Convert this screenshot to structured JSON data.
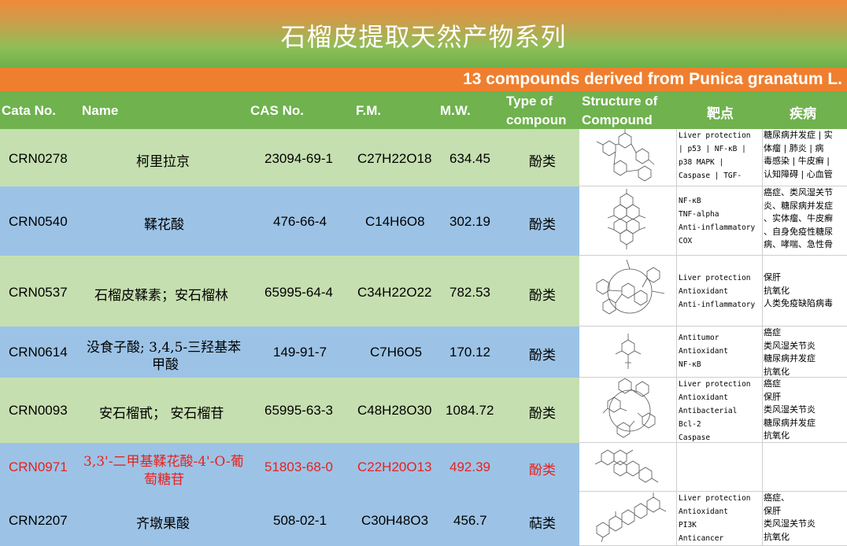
{
  "title": "石榴皮提取天然产物系列",
  "subtitle": "13 compounds derived from Punica granatum L.",
  "headers": {
    "cata": "Cata No.",
    "name": "Name",
    "cas": "CAS No.",
    "fm": "F.M.",
    "mw": "M.W.",
    "type_1": "Type of",
    "type_2": "compoun",
    "structure_1": "Structure of",
    "structure_2": "Compound",
    "target": "靶点",
    "disease": "疾病"
  },
  "colors": {
    "green_row": "#c6dfb0",
    "blue_row": "#9cc3e6",
    "header_green": "#6fb24e",
    "orange_band": "#ef7f2e",
    "highlight_red": "#e8211d"
  },
  "rows": [
    {
      "cata": "CRN0278",
      "name_1": "柯里拉京",
      "name_2": "",
      "cas": "23094-69-1",
      "fm": "C27H22O18",
      "mw": "634.45",
      "type": "酚类",
      "targets": [
        "Liver protection",
        "| p53 | NF-κB |",
        "p38 MAPK |",
        "Caspase | TGF-"
      ],
      "diseases": [
        "糖尿病并发症 | 实",
        "体瘤 | 肺炎 | 病",
        "毒感染 | 牛皮癣 |",
        "认知障碍 | 心血管"
      ]
    },
    {
      "cata": "CRN0540",
      "name_1": "鞣花酸",
      "name_2": "",
      "cas": "476-66-4",
      "fm": "C14H6O8",
      "mw": "302.19",
      "type": "酚类",
      "targets": [
        "NF-κB",
        "TNF-alpha",
        "Anti-inflammatory",
        "COX"
      ],
      "diseases": [
        "癌症、类风湿关节",
        "炎、糖尿病并发症",
        "、实体瘤、牛皮癣",
        "、自身免疫性糖尿",
        "病、哮喘、急性骨"
      ]
    },
    {
      "cata": "CRN0537",
      "name_1": "石榴皮鞣素；安石榴林",
      "name_2": "",
      "cas": "65995-64-4",
      "fm": "C34H22O22",
      "mw": "782.53",
      "type": "酚类",
      "targets": [
        "Liver protection",
        "Antioxidant",
        "Anti-inflammatory"
      ],
      "diseases": [
        "保肝",
        "抗氧化",
        "人类免疫缺陷病毒"
      ]
    },
    {
      "cata": "CRN0614",
      "name_1": "没食子酸; 3,4,5-三羟基苯",
      "name_2": "甲酸",
      "cas": "149-91-7",
      "fm": "C7H6O5",
      "mw": "170.12",
      "type": "酚类",
      "targets": [
        "Antitumor",
        "Antioxidant",
        "NF-κB"
      ],
      "diseases": [
        "癌症",
        "类风湿关节炎",
        "糖尿病并发症",
        "抗氧化"
      ]
    },
    {
      "cata": "CRN0093",
      "name_1": "安石榴甙； 安石榴苷",
      "name_2": "",
      "cas": "65995-63-3",
      "fm": "C48H28O30",
      "mw": "1084.72",
      "type": "酚类",
      "targets": [
        "Liver protection",
        "Antioxidant",
        "Antibacterial",
        "Bcl-2",
        "Caspase"
      ],
      "diseases": [
        "癌症",
        "保肝",
        "类风湿关节炎",
        "糖尿病并发症",
        "抗氧化"
      ]
    },
    {
      "cata": "CRN0971",
      "name_1": "3,3'-二甲基鞣花酸-4'-O-葡",
      "name_2": "萄糖苷",
      "cas": "51803-68-0",
      "fm": "C22H20O13",
      "mw": "492.39",
      "type": "酚类",
      "targets": [],
      "diseases": []
    },
    {
      "cata": "CRN2207",
      "name_1": "齐墩果酸",
      "name_2": "",
      "cas": "508-02-1",
      "fm": "C30H48O3",
      "mw": "456.7",
      "type": "萜类",
      "targets": [
        "Liver protection",
        "Antioxidant",
        "PI3K",
        "Anticancer"
      ],
      "diseases": [
        "癌症、",
        "保肝",
        "类风湿关节炎",
        "抗氧化"
      ]
    }
  ]
}
